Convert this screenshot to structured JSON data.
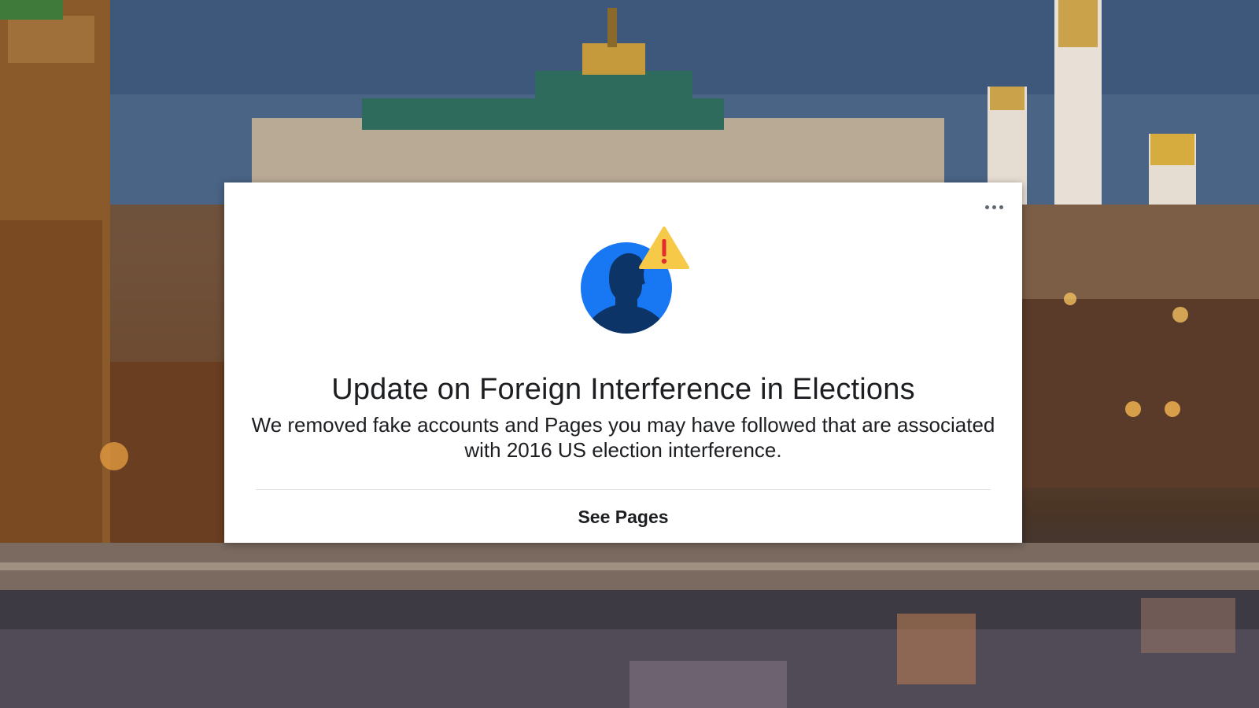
{
  "notice": {
    "title": "Update on Foreign Interference in Elections",
    "body": "We removed fake accounts and Pages you may have followed that are associated with 2016 US election interference.",
    "action_label": "See Pages",
    "more_icon": "more-horizontal-icon",
    "avatar_icon": "person-silhouette-icon",
    "warning_icon": "warning-triangle-icon"
  },
  "colors": {
    "card_background": "#ffffff",
    "text": "#1c1e21",
    "avatar_blue": "#1877f2",
    "silhouette": "#0d3466",
    "warning_yellow": "#f7c948",
    "warning_mark": "#e02d2d"
  }
}
